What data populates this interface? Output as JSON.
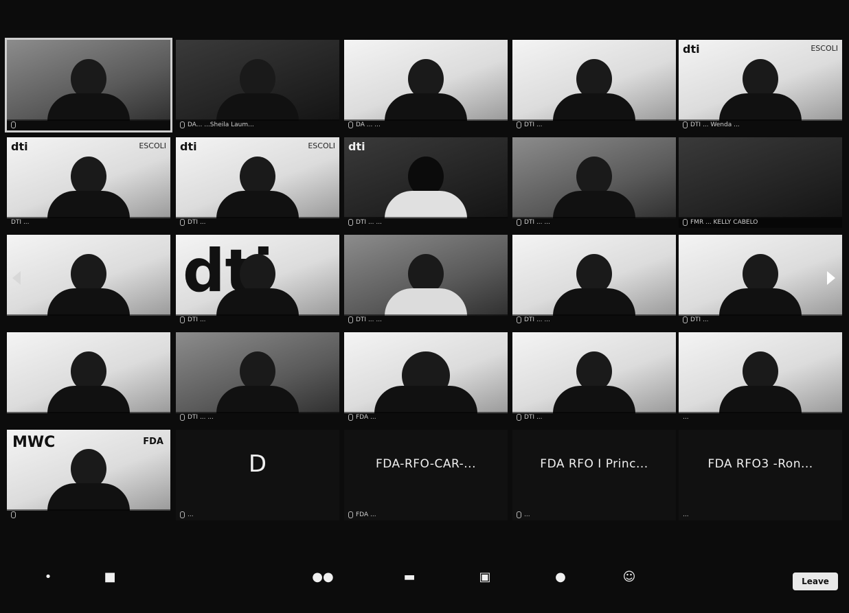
{
  "tiles": [
    {
      "id": "t1",
      "name": "",
      "style": "mid",
      "active": true
    },
    {
      "id": "t2",
      "name": "DA... ...Sheila Laum...",
      "style": "dark"
    },
    {
      "id": "t3",
      "name": "DA ... ...",
      "style": "bright"
    },
    {
      "id": "t4",
      "name": "DTI ...",
      "style": "bright"
    },
    {
      "id": "t5",
      "name": "DTI ... Wenda ...",
      "style": "bright",
      "brand": "dti",
      "brand2": "ESCOLI"
    },
    {
      "id": "t6",
      "name": "DTI ...",
      "style": "bright",
      "brand": "dti",
      "brand2": "ESCOLI"
    },
    {
      "id": "t7",
      "name": "DTI ...",
      "style": "bright",
      "brand": "dti",
      "brand2": "ESCOLI"
    },
    {
      "id": "t8",
      "name": "DTI ... ...",
      "style": "dark",
      "brand": "dti"
    },
    {
      "id": "t9",
      "name": "DTI ... ...",
      "style": "mid"
    },
    {
      "id": "t10",
      "name": "FMR ... KELLY CABELO",
      "style": "dark"
    },
    {
      "id": "t11",
      "name": "",
      "style": "bright"
    },
    {
      "id": "t12",
      "name": "DTI ...",
      "style": "bright",
      "dtiBig": "dti"
    },
    {
      "id": "t13",
      "name": "DTI ... ...",
      "style": "mid"
    },
    {
      "id": "t14",
      "name": "DTI ... ...",
      "style": "bright"
    },
    {
      "id": "t15",
      "name": "DTI ...",
      "style": "bright"
    },
    {
      "id": "t16",
      "name": "",
      "style": "bright"
    },
    {
      "id": "t17",
      "name": "DTI ... ...",
      "style": "mid"
    },
    {
      "id": "t18",
      "name": "FDA ...",
      "style": "bright"
    },
    {
      "id": "t19",
      "name": "DTI ...",
      "style": "bright"
    },
    {
      "id": "t20",
      "name": "...",
      "style": "bright"
    },
    {
      "id": "t21",
      "name": "",
      "style": "bright",
      "mwc": "MWC",
      "fda": "FDA"
    },
    {
      "id": "t22",
      "name": "...",
      "style": "dark",
      "letter": "D"
    },
    {
      "id": "t23",
      "name": "FDA ...",
      "style": "dark",
      "bigName": "FDA-RFO-CAR-..."
    },
    {
      "id": "t24",
      "name": "...",
      "style": "dark",
      "bigName": "FDA RFO I Princ..."
    },
    {
      "id": "t25",
      "name": "...",
      "style": "dark",
      "bigName": "FDA RFO3 -Ron..."
    }
  ],
  "toolbar": {
    "leave_label": "Leave"
  }
}
